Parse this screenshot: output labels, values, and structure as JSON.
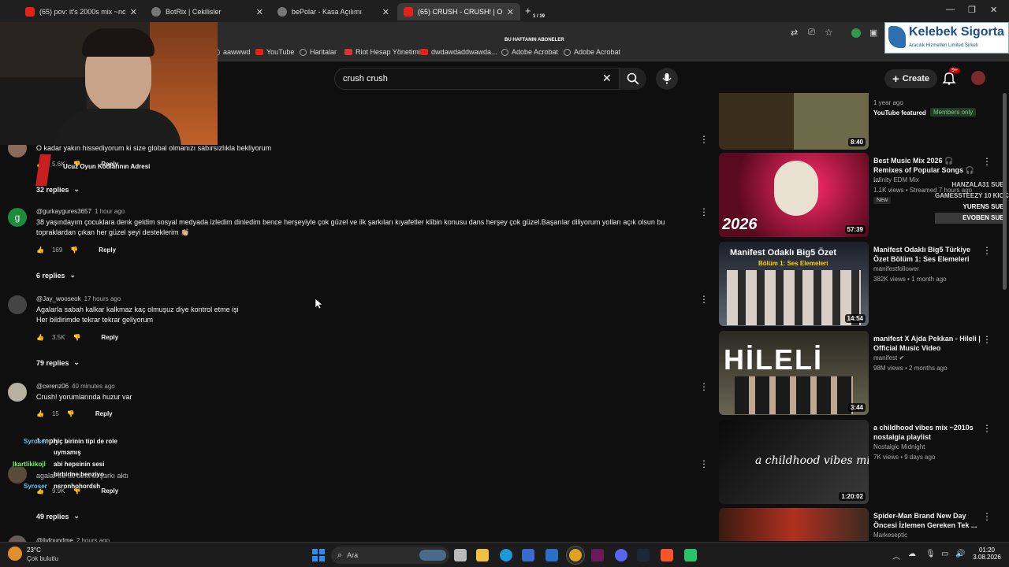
{
  "tabs": [
    {
      "title": "(65) pov: it's 2000s mix ~nostal",
      "icon": "youtube-icon"
    },
    {
      "title": "BotRix | Cekilisler",
      "icon": "botrix-icon"
    },
    {
      "title": "bePolar - Kasa Açılımı",
      "icon": "globe-icon"
    },
    {
      "title": "(65) CRUSH - CRUSH! | Official M",
      "icon": "youtube-icon"
    }
  ],
  "tab_counter": "1 / 19",
  "overlay_banner": "BU HAFTANIN ABONELER",
  "bookmarks": [
    {
      "label": "aawwwd",
      "icon": "globe-icon"
    },
    {
      "label": "YouTube",
      "icon": "youtube-icon"
    },
    {
      "label": "Haritalar",
      "icon": "globe-icon"
    },
    {
      "label": "Riot Hesap Yönetimi",
      "icon": "riot-icon"
    },
    {
      "label": "dwdawdaddwawda...",
      "icon": "youtube-icon"
    },
    {
      "label": "Adobe Acrobat",
      "icon": "globe-icon"
    },
    {
      "label": "Adobe Acrobat",
      "icon": "globe-icon"
    }
  ],
  "sponsor": {
    "title": "Kelebek Sigorta",
    "subtitle": "Aracılık Hizmetleri Limited Şirketi"
  },
  "search": {
    "value": "crush crush"
  },
  "header": {
    "create_label": "Create",
    "notif_badge": "9+"
  },
  "comments": [
    {
      "author": "",
      "time": "",
      "text": "O kadar yakın hissediyorum ki size global olmanızı sabırsızlıkla bekliyorum",
      "likes": "5.6K",
      "reply": "Reply",
      "replies": "32 replies"
    },
    {
      "author": "@gurkaygures3657",
      "time": "1 hour ago",
      "text": "38 yaşındayım çocuklara denk geldim sosyal medyada izledim dinledim bence herşeyiyle çok güzel ve ilk şarkıları kıyafetler klibin konusu dans herşey çok güzel.Başarılar diliyorum yolları açık olsun bu topraklardan çıkan her güzel şeyi desteklerim 👏🏼",
      "likes": "169",
      "reply": "Reply",
      "replies": "6 replies"
    },
    {
      "author": "@Jay_wooseok",
      "time": "17 hours ago",
      "text": "Agalarla sabah kalkar kalkmaz kaç olmuşuz diye kontrol etme işi\nHer bildirimde tekrar tekrar geliyorum",
      "likes": "3.5K",
      "reply": "Reply",
      "replies": "79 replies"
    },
    {
      "author": "@cerenz06",
      "time": "40 minutes ago",
      "text": "Crush! yorumlarında huzur var",
      "likes": "15",
      "reply": "Reply",
      "replies": "1 reply"
    },
    {
      "author": "",
      "time": "",
      "text": "agalar bu ilk defa bi şarkı aktı",
      "likes": "9.9K",
      "reply": "Reply",
      "replies": "49 replies"
    },
    {
      "author": "@livfoundme",
      "time": "2 hours ago",
      "text": "",
      "likes": "",
      "reply": "",
      "replies": ""
    }
  ],
  "stream_overlay": {
    "promo": "Ucuz Oyun Kodlarının Adresi",
    "chat": [
      {
        "user": "Syroser",
        "msg": "hiç birinin tipi de role"
      },
      {
        "user": "",
        "msg": "uymamış"
      },
      {
        "user": "Ikartlikikojl",
        "msg": "abi hepsinin sesi"
      },
      {
        "user": "",
        "msg": "birbirine benziyo"
      },
      {
        "user": "Syroser",
        "msg": "nsronhohordsh"
      }
    ],
    "sub_labels": [
      "HANZALA31 SUB",
      "GAMESSTEEZY 10 KICKS",
      "YURENS SUB",
      "EVOBEN SUB"
    ]
  },
  "videos": [
    {
      "title": "",
      "channel": "YouTube featured",
      "meta": "1 year ago",
      "badge": "Members only",
      "duration": "8:40",
      "thumb_colors": [
        "#3b2d1c",
        "#6d6a4a"
      ]
    },
    {
      "title": "Best Music Mix 2026 🎧 Remixes of Popular Songs 🎧 ...",
      "channel": "Infinity EDM Mix",
      "meta": "1.1K views • Streamed 7 hours ago",
      "badge": "New",
      "duration": "57:39",
      "thumb_text": "2026",
      "thumb_colors": [
        "#8a0a2a",
        "#ff2a6a"
      ]
    },
    {
      "title": "Manifest Odaklı Big5 Türkiye Özet Bölüm 1: Ses Elemeleri",
      "channel": "manifestfollower",
      "meta": "382K views • 1 month ago",
      "duration": "14:54",
      "thumb_text": "Manifest Odaklı Big5 Özet",
      "thumb_sub": "Bölüm 1: Ses Elemeleri",
      "thumb_colors": [
        "#202530",
        "#5a5f6a"
      ]
    },
    {
      "title": "manifest X Ajda Pekkan - Hileli | Official Music Video",
      "channel": "manifest",
      "meta": "98M views • 2 months ago",
      "duration": "3:44",
      "thumb_text": "HİLELİ",
      "thumb_colors": [
        "#2a2a22",
        "#6a6552"
      ]
    },
    {
      "title": "a childhood vibes mix ~2010s nostalgia playlist",
      "channel": "Nostalgic Midnight",
      "meta": "7K views • 9 days ago",
      "duration": "1:20:02",
      "thumb_text": "a childhood vibes mix",
      "thumb_colors": [
        "#0a0a0a",
        "#3a3a3a"
      ]
    },
    {
      "title": "Spider-Man Brand New Day Öncesi İzlemen Gereken Tek ...",
      "channel": "Markeseptic",
      "meta": "",
      "duration": "",
      "thumb_colors": [
        "#3a1a10",
        "#b03020"
      ]
    }
  ],
  "taskbar": {
    "weather_temp": "23°C",
    "weather_desc": "Çok bulutlu",
    "search_label": "Ara",
    "time": "01:20",
    "date": "3.08.2026"
  },
  "colors": {
    "bg": "#0f0f0f",
    "accent": "#e62117",
    "link": "#3ea6ff"
  }
}
